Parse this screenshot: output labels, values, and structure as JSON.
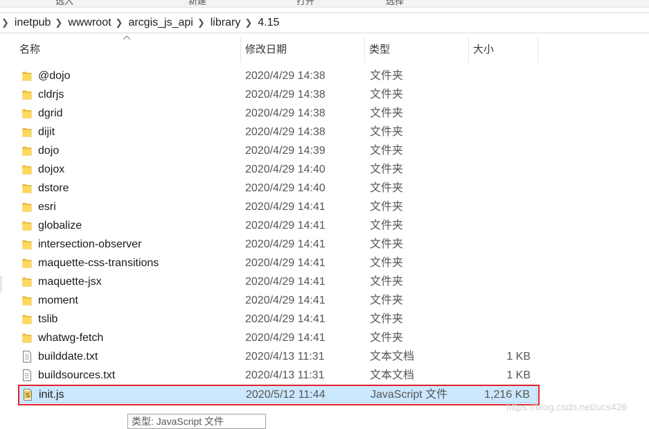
{
  "ribbon": {
    "items": [
      "选入",
      "新建",
      "打开",
      "选择"
    ]
  },
  "address": {
    "crumbs": [
      "inetpub",
      "wwwroot",
      "arcgis_js_api",
      "library",
      "4.15"
    ]
  },
  "columns": {
    "name": "名称",
    "date": "修改日期",
    "type": "类型",
    "size": "大小"
  },
  "files": [
    {
      "name": "@dojo",
      "date": "2020/4/29 14:38",
      "type": "文件夹",
      "size": "",
      "icon": "folder-icon"
    },
    {
      "name": "cldrjs",
      "date": "2020/4/29 14:38",
      "type": "文件夹",
      "size": "",
      "icon": "folder-icon"
    },
    {
      "name": "dgrid",
      "date": "2020/4/29 14:38",
      "type": "文件夹",
      "size": "",
      "icon": "folder-icon"
    },
    {
      "name": "dijit",
      "date": "2020/4/29 14:38",
      "type": "文件夹",
      "size": "",
      "icon": "folder-icon"
    },
    {
      "name": "dojo",
      "date": "2020/4/29 14:39",
      "type": "文件夹",
      "size": "",
      "icon": "folder-icon"
    },
    {
      "name": "dojox",
      "date": "2020/4/29 14:40",
      "type": "文件夹",
      "size": "",
      "icon": "folder-icon"
    },
    {
      "name": "dstore",
      "date": "2020/4/29 14:40",
      "type": "文件夹",
      "size": "",
      "icon": "folder-icon"
    },
    {
      "name": "esri",
      "date": "2020/4/29 14:41",
      "type": "文件夹",
      "size": "",
      "icon": "folder-icon"
    },
    {
      "name": "globalize",
      "date": "2020/4/29 14:41",
      "type": "文件夹",
      "size": "",
      "icon": "folder-icon"
    },
    {
      "name": "intersection-observer",
      "date": "2020/4/29 14:41",
      "type": "文件夹",
      "size": "",
      "icon": "folder-icon"
    },
    {
      "name": "maquette-css-transitions",
      "date": "2020/4/29 14:41",
      "type": "文件夹",
      "size": "",
      "icon": "folder-icon"
    },
    {
      "name": "maquette-jsx",
      "date": "2020/4/29 14:41",
      "type": "文件夹",
      "size": "",
      "icon": "folder-icon"
    },
    {
      "name": "moment",
      "date": "2020/4/29 14:41",
      "type": "文件夹",
      "size": "",
      "icon": "folder-icon"
    },
    {
      "name": "tslib",
      "date": "2020/4/29 14:41",
      "type": "文件夹",
      "size": "",
      "icon": "folder-icon"
    },
    {
      "name": "whatwg-fetch",
      "date": "2020/4/29 14:41",
      "type": "文件夹",
      "size": "",
      "icon": "folder-icon"
    },
    {
      "name": "builddate.txt",
      "date": "2020/4/13 11:31",
      "type": "文本文档",
      "size": "1 KB",
      "icon": "text-file-icon"
    },
    {
      "name": "buildsources.txt",
      "date": "2020/4/13 11:31",
      "type": "文本文档",
      "size": "1 KB",
      "icon": "text-file-icon"
    },
    {
      "name": "init.js",
      "date": "2020/5/12 11:44",
      "type": "JavaScript 文件",
      "size": "1,216 KB",
      "icon": "javascript-file-icon",
      "selected": true
    }
  ],
  "tooltip": "类型: JavaScript 文件",
  "watermark": "https://blog.csdn.net/ucs426",
  "colors": {
    "selection_bg": "#cce8ff",
    "selection_border": "#99d1ff",
    "highlight_box": "#e3212a",
    "folder": "#f7c948"
  }
}
